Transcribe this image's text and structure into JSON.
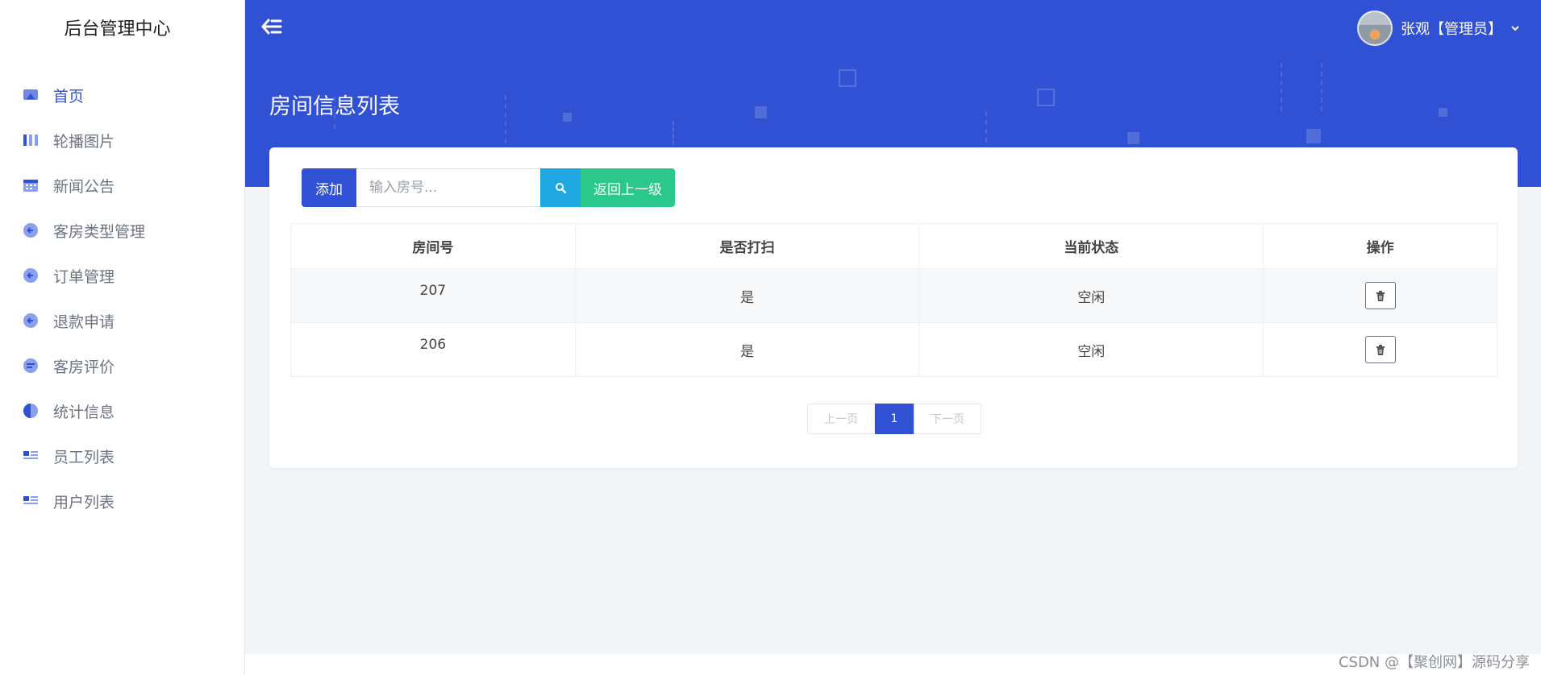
{
  "sidebar": {
    "brand": "后台管理中心",
    "items": [
      {
        "label": "首页",
        "icon": "home-icon"
      },
      {
        "label": "轮播图片",
        "icon": "carousel-icon"
      },
      {
        "label": "新闻公告",
        "icon": "calendar-icon"
      },
      {
        "label": "客房类型管理",
        "icon": "arrow-left-circle-icon"
      },
      {
        "label": "订单管理",
        "icon": "arrow-left-circle-icon"
      },
      {
        "label": "退款申请",
        "icon": "arrow-left-circle-icon"
      },
      {
        "label": "客房评价",
        "icon": "comment-icon"
      },
      {
        "label": "统计信息",
        "icon": "pie-chart-icon"
      },
      {
        "label": "员工列表",
        "icon": "list-icon"
      },
      {
        "label": "用户列表",
        "icon": "list-icon"
      }
    ]
  },
  "header": {
    "page_title": "房间信息列表",
    "user_label": "张观【管理员】"
  },
  "toolbar": {
    "add_label": "添加",
    "search_placeholder": "输入房号...",
    "back_label": "返回上一级"
  },
  "table": {
    "columns": [
      "房间号",
      "是否打扫",
      "当前状态",
      "操作"
    ],
    "rows": [
      {
        "room": "207",
        "cleaned": "是",
        "status": "空闲"
      },
      {
        "room": "206",
        "cleaned": "是",
        "status": "空闲"
      }
    ]
  },
  "pagination": {
    "prev_label": "上一页",
    "current": "1",
    "next_label": "下一页"
  },
  "watermark": "CSDN @【聚创网】源码分享",
  "colors": {
    "primary": "#3051d3",
    "search_button": "#1ea7e0",
    "back_button": "#2bc88b",
    "background": "#f2f5f7"
  }
}
